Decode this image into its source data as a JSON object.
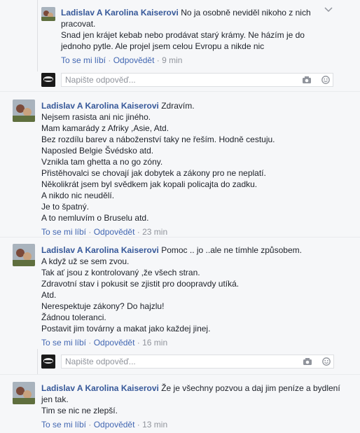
{
  "comments": [
    {
      "author": "Ladislav A Karolina Kaiserovi",
      "first_line": "No ja osobně neviděl nikoho z nich",
      "lines": [
        "pracovat.",
        "Snad jen krájet kebab nebo prodávat starý krámy. Ne házím je do",
        "jednoho pytle. Ale projel jsem celou Evropu a nikde nic"
      ],
      "like": "To se mi líbí",
      "reply": "Odpovědět",
      "time": "9 min"
    },
    {
      "author": "Ladislav A Karolina Kaiserovi",
      "first_line": "Zdravím.",
      "lines": [
        "Nejsem rasista ani nic jiného.",
        "Mam kamarády z Afriky ,Asie, Atd.",
        "Bez rozdílu barev a náboženství taky ne řeším. Hodně cestuju.",
        "Naposled Belgie Švédsko atd.",
        "Vznikla tam ghetta a no go zóny.",
        "Přistěhovalci se chovají jak dobytek a zákony pro ne neplatí.",
        "Několikrát jsem byl svědkem jak kopali policajta do zadku.",
        "A nikdo nic neudělí.",
        "Je to špatný.",
        "A to nemluvím o Bruselu atd."
      ],
      "like": "To se mi líbí",
      "reply": "Odpovědět",
      "time": "23 min"
    },
    {
      "author": "Ladislav A Karolina Kaiserovi",
      "first_line": "Pomoc .. jo ..ale ne tímhle způsobem.",
      "lines": [
        "A když už se sem zvou.",
        "Tak ať jsou z kontrolovaný ,že všech stran.",
        "Zdravotní stav i pokusit se zjistit pro doopravdy utíká.",
        "Atd.",
        "Nerespektuje zákony? Do hajzlu!",
        "Žádnou toleranci.",
        "Postavit jim továrny a makat jako každej jinej."
      ],
      "like": "To se mi líbí",
      "reply": "Odpovědět",
      "time": "16 min"
    },
    {
      "author": "Ladislav A Karolina Kaiserovi",
      "first_line": "Že je všechny pozvou a daj jim peníze a bydlení",
      "lines": [
        "jen tak.",
        "Tim se nic ne zlepší."
      ],
      "like": "To se mi líbí",
      "reply": "Odpovědět",
      "time": "13 min"
    }
  ],
  "reply_placeholder": "Napište odpověď...",
  "separator": "·"
}
